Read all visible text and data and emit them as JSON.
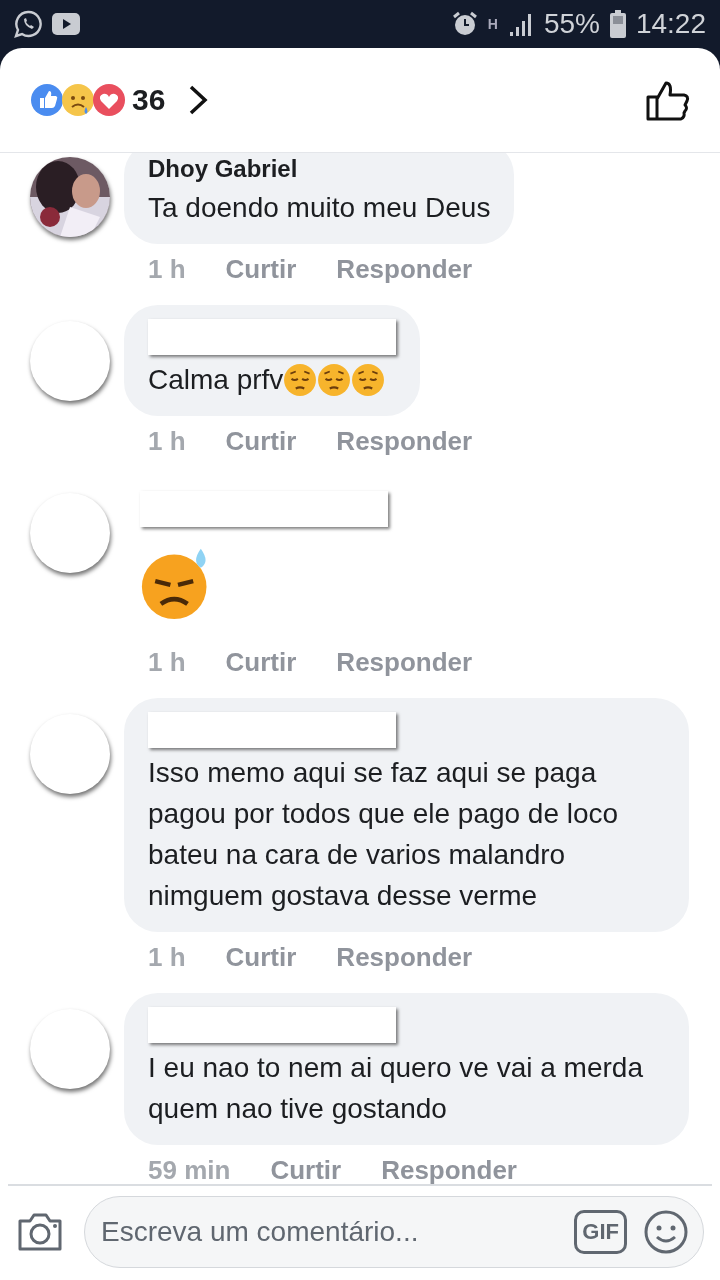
{
  "status_bar": {
    "battery": "55%",
    "time": "14:22",
    "network": "H"
  },
  "header": {
    "reaction_count": "36"
  },
  "comments": [
    {
      "author": "Dhoy Gabriel",
      "kind": "text",
      "text": "Ta doendo muito meu Deus",
      "time": "1 h",
      "like": "Curtir",
      "reply": "Responder"
    },
    {
      "avatar": {
        "kind": "blank"
      },
      "kind": "text",
      "text": "Calma prfv",
      "emojis": [
        {
          "kind": "pensive"
        },
        {
          "kind": "pensive"
        },
        {
          "kind": "pensive"
        }
      ],
      "time": "1 h",
      "like": "Curtir",
      "reply": "Responder"
    },
    {
      "avatar": {
        "kind": "blank"
      },
      "kind": "sticker",
      "emojis": [
        {
          "kind": "downcast-sweat"
        }
      ],
      "time": "1 h",
      "like": "Curtir",
      "reply": "Responder"
    },
    {
      "avatar": {
        "kind": "blank"
      },
      "kind": "text",
      "text": "Isso memo aqui se faz aqui se paga pagou por todos que ele pago de loco bateu na cara de varios malandro nimguem gostava desse verme",
      "time": "1 h",
      "like": "Curtir",
      "reply": "Responder"
    },
    {
      "avatar": {
        "kind": "blank"
      },
      "kind": "text",
      "text": "I eu nao to nem ai quero ve vai a merda quem nao tive gostando",
      "time": "59 min",
      "like": "Curtir",
      "reply": "Responder"
    }
  ],
  "composer": {
    "placeholder": "Escreva um comentário...",
    "gif": "GIF"
  }
}
